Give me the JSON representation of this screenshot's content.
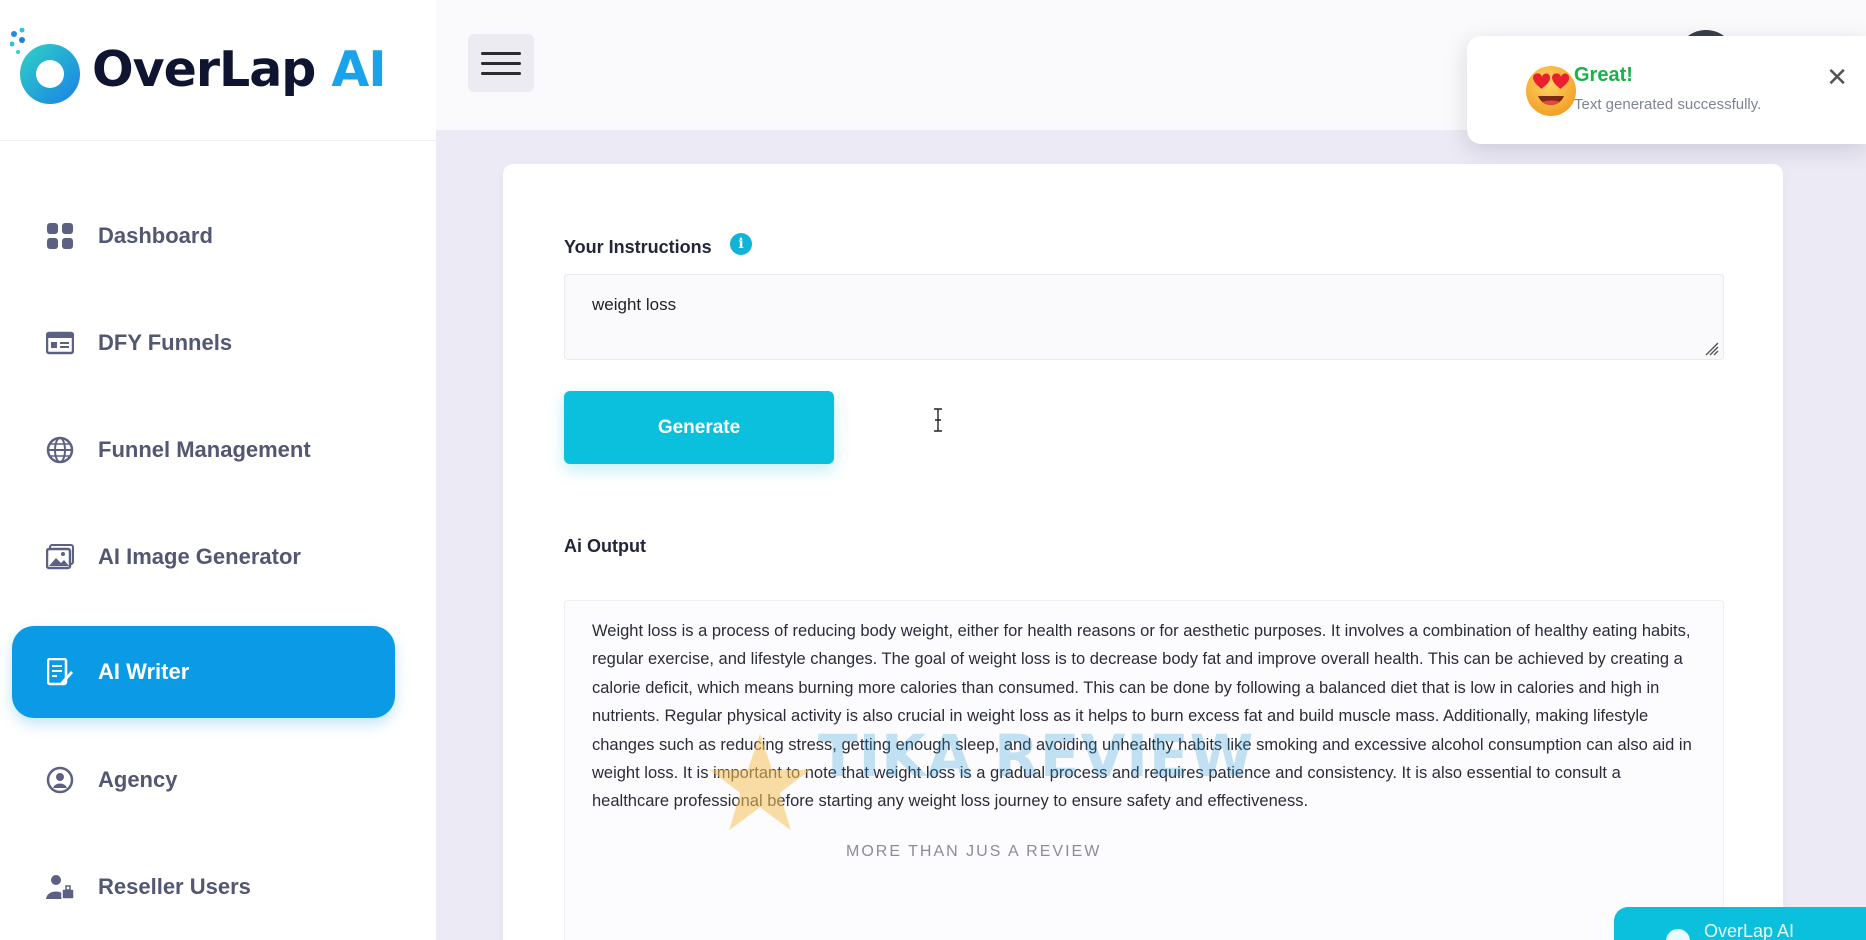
{
  "app": {
    "logo_main": "OverLap ",
    "logo_ai": "AI"
  },
  "sidebar": {
    "items": [
      {
        "label": "Dashboard",
        "icon": "grid-icon",
        "active": false
      },
      {
        "label": "DFY Funnels",
        "icon": "card-icon",
        "active": false
      },
      {
        "label": "Funnel Management",
        "icon": "globe-icon",
        "active": false
      },
      {
        "label": "AI Image Generator",
        "icon": "image-icon",
        "active": false
      },
      {
        "label": "AI Writer",
        "icon": "document-edit-icon",
        "active": true
      },
      {
        "label": "Agency",
        "icon": "user-circle-icon",
        "active": false
      },
      {
        "label": "Reseller Users",
        "icon": "users-icon",
        "active": false
      }
    ]
  },
  "toast": {
    "title": "Great!",
    "message": "Text generated successfully.",
    "icon": "heart-eyes-emoji-icon"
  },
  "form": {
    "instructions_label": "Your Instructions",
    "instructions_value": "weight loss",
    "generate_label": "Generate",
    "output_label": "Ai Output",
    "output_text": "Weight loss is a process of reducing body weight, either for health reasons or for aesthetic purposes. It involves a combination of healthy eating habits, regular exercise, and lifestyle changes. The goal of weight loss is to decrease body fat and improve overall health. This can be achieved by creating a calorie deficit, which means burning more calories than consumed. This can be done by following a balanced diet that is low in calories and high in nutrients. Regular physical activity is also crucial in weight loss as it helps to burn excess fat and build muscle mass. Additionally, making lifestyle changes such as reducing stress, getting enough sleep, and avoiding unhealthy habits like smoking and excessive alcohol consumption can also aid in weight loss. It is important to note that weight loss is a gradual process and requires patience and consistency. It is also essential to consult a healthcare professional before starting any weight loss journey to ensure safety and effectiveness."
  },
  "watermark": {
    "title": "TIKA REVIEW",
    "subtitle": "MORE THAN JUS A REVIEW"
  },
  "chat": {
    "label": "OverLap AI"
  },
  "colors": {
    "primary": "#0a9ae6",
    "accent": "#0bc0dc",
    "success": "#19b24a"
  }
}
